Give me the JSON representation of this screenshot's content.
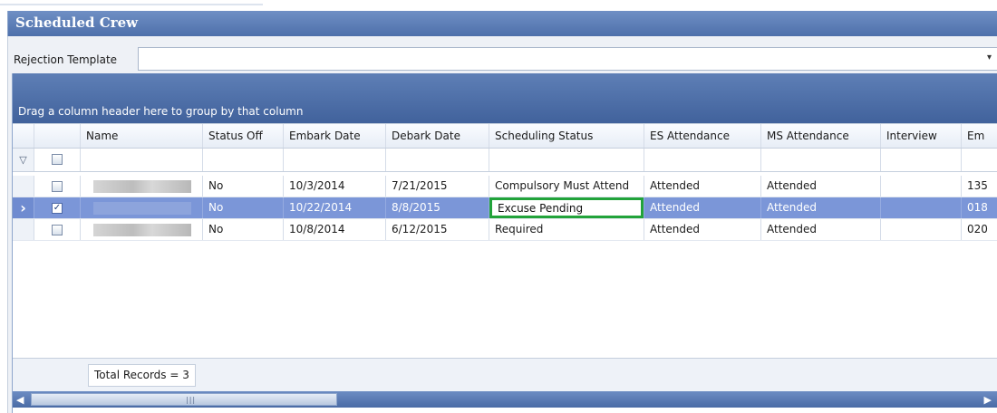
{
  "window": {
    "title": "Scheduled Crew"
  },
  "rejection": {
    "label": "Rejection Template",
    "value": ""
  },
  "grid": {
    "group_hint": "Drag a column header here to group by that column",
    "columns": [
      "Name",
      "Status Off",
      "Embark Date",
      "Debark Date",
      "Scheduling Status",
      "ES Attendance",
      "MS Attendance",
      "Interview",
      "Em"
    ],
    "rows": [
      {
        "checked": "",
        "status_off": "No",
        "embark": "10/3/2014",
        "debark": "7/21/2015",
        "scheduling": "Compulsory Must Attend",
        "es": "Attended",
        "ms": "Attended",
        "interview": "",
        "em": "135"
      },
      {
        "checked": "✓",
        "status_off": "No",
        "embark": "10/22/2014",
        "debark": "8/8/2015",
        "scheduling": "Excuse Pending",
        "es": "Attended",
        "ms": "Attended",
        "interview": "",
        "em": "018"
      },
      {
        "checked": "",
        "status_off": "No",
        "embark": "10/8/2014",
        "debark": "6/12/2015",
        "scheduling": "Required",
        "es": "Attended",
        "ms": "Attended",
        "interview": "",
        "em": "020"
      }
    ],
    "selected_indicator": "›",
    "footer_total": "Total Records = 3"
  },
  "icons": {
    "filter": "filter-icon",
    "dropdown": "chevron-down-icon",
    "scroll_left": "arrow-left-icon",
    "scroll_right": "arrow-right-icon"
  },
  "colors": {
    "title_bar": "#5a7bb5",
    "selected_row": "#7b96d8",
    "edit_border": "#22a33a"
  }
}
